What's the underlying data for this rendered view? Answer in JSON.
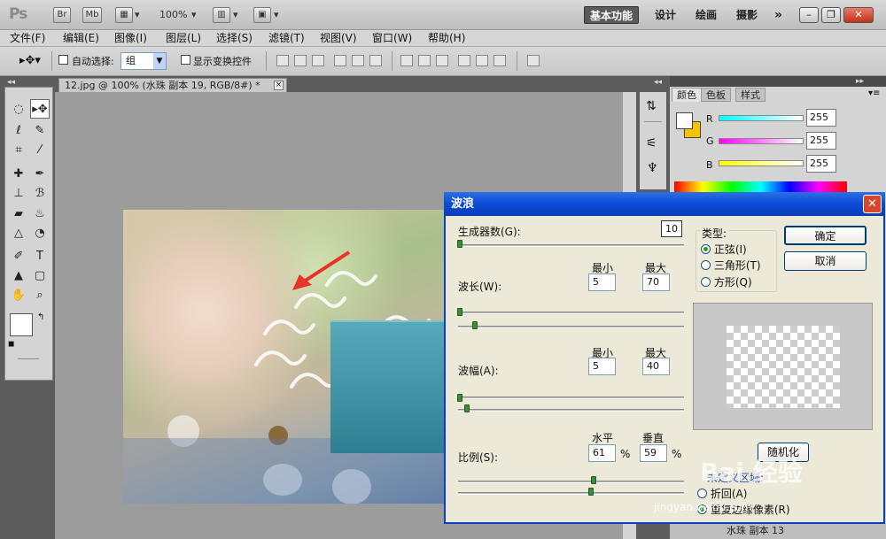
{
  "app": {
    "logo": "Ps",
    "bridge": "Br",
    "minibridge": "Mb",
    "zoom": "100%"
  },
  "workspaces": [
    "基本功能",
    "设计",
    "绘画",
    "摄影",
    "»"
  ],
  "menu": [
    "文件(F)",
    "编辑(E)",
    "图像(I)",
    "图层(L)",
    "选择(S)",
    "滤镜(T)",
    "视图(V)",
    "窗口(W)",
    "帮助(H)"
  ],
  "options": {
    "auto_select_label": "自动选择:",
    "auto_select_value": "组",
    "show_transform_label": "显示变换控件"
  },
  "document": {
    "tab_title": "12.jpg @ 100% (水珠 副本 19, RGB/8#) *",
    "close": "×"
  },
  "panel": {
    "tabs": [
      "颜色",
      "色板",
      "样式"
    ],
    "r_label": "R",
    "g_label": "G",
    "b_label": "B",
    "r_value": "255",
    "g_value": "255",
    "b_value": "255"
  },
  "dialog": {
    "title": "波浪",
    "generators_label": "生成器数(G):",
    "generators_value": "10",
    "min_label": "最小",
    "max_label": "最大",
    "wavelength_label": "波长(W):",
    "wavelength_min": "5",
    "wavelength_max": "70",
    "amplitude_label": "波幅(A):",
    "amplitude_min": "5",
    "amplitude_max": "40",
    "scale_label": "比例(S):",
    "horizontal_label": "水平",
    "vertical_label": "垂直",
    "scale_h": "61",
    "scale_v": "59",
    "percent": "%",
    "type_label": "类型:",
    "type_options": [
      "正弦(I)",
      "三角形(T)",
      "方形(Q)"
    ],
    "ok": "确定",
    "cancel": "取消",
    "randomize": "随机化",
    "undefined_label": "未定义区域:",
    "undefined_options": [
      "折回(A)",
      "重复边缘像素(R)"
    ]
  },
  "layers": {
    "bottom_layer": "水珠 副本 13"
  },
  "watermark": {
    "brand": "Bai 经验",
    "url": "jingyan.baidu.com"
  }
}
